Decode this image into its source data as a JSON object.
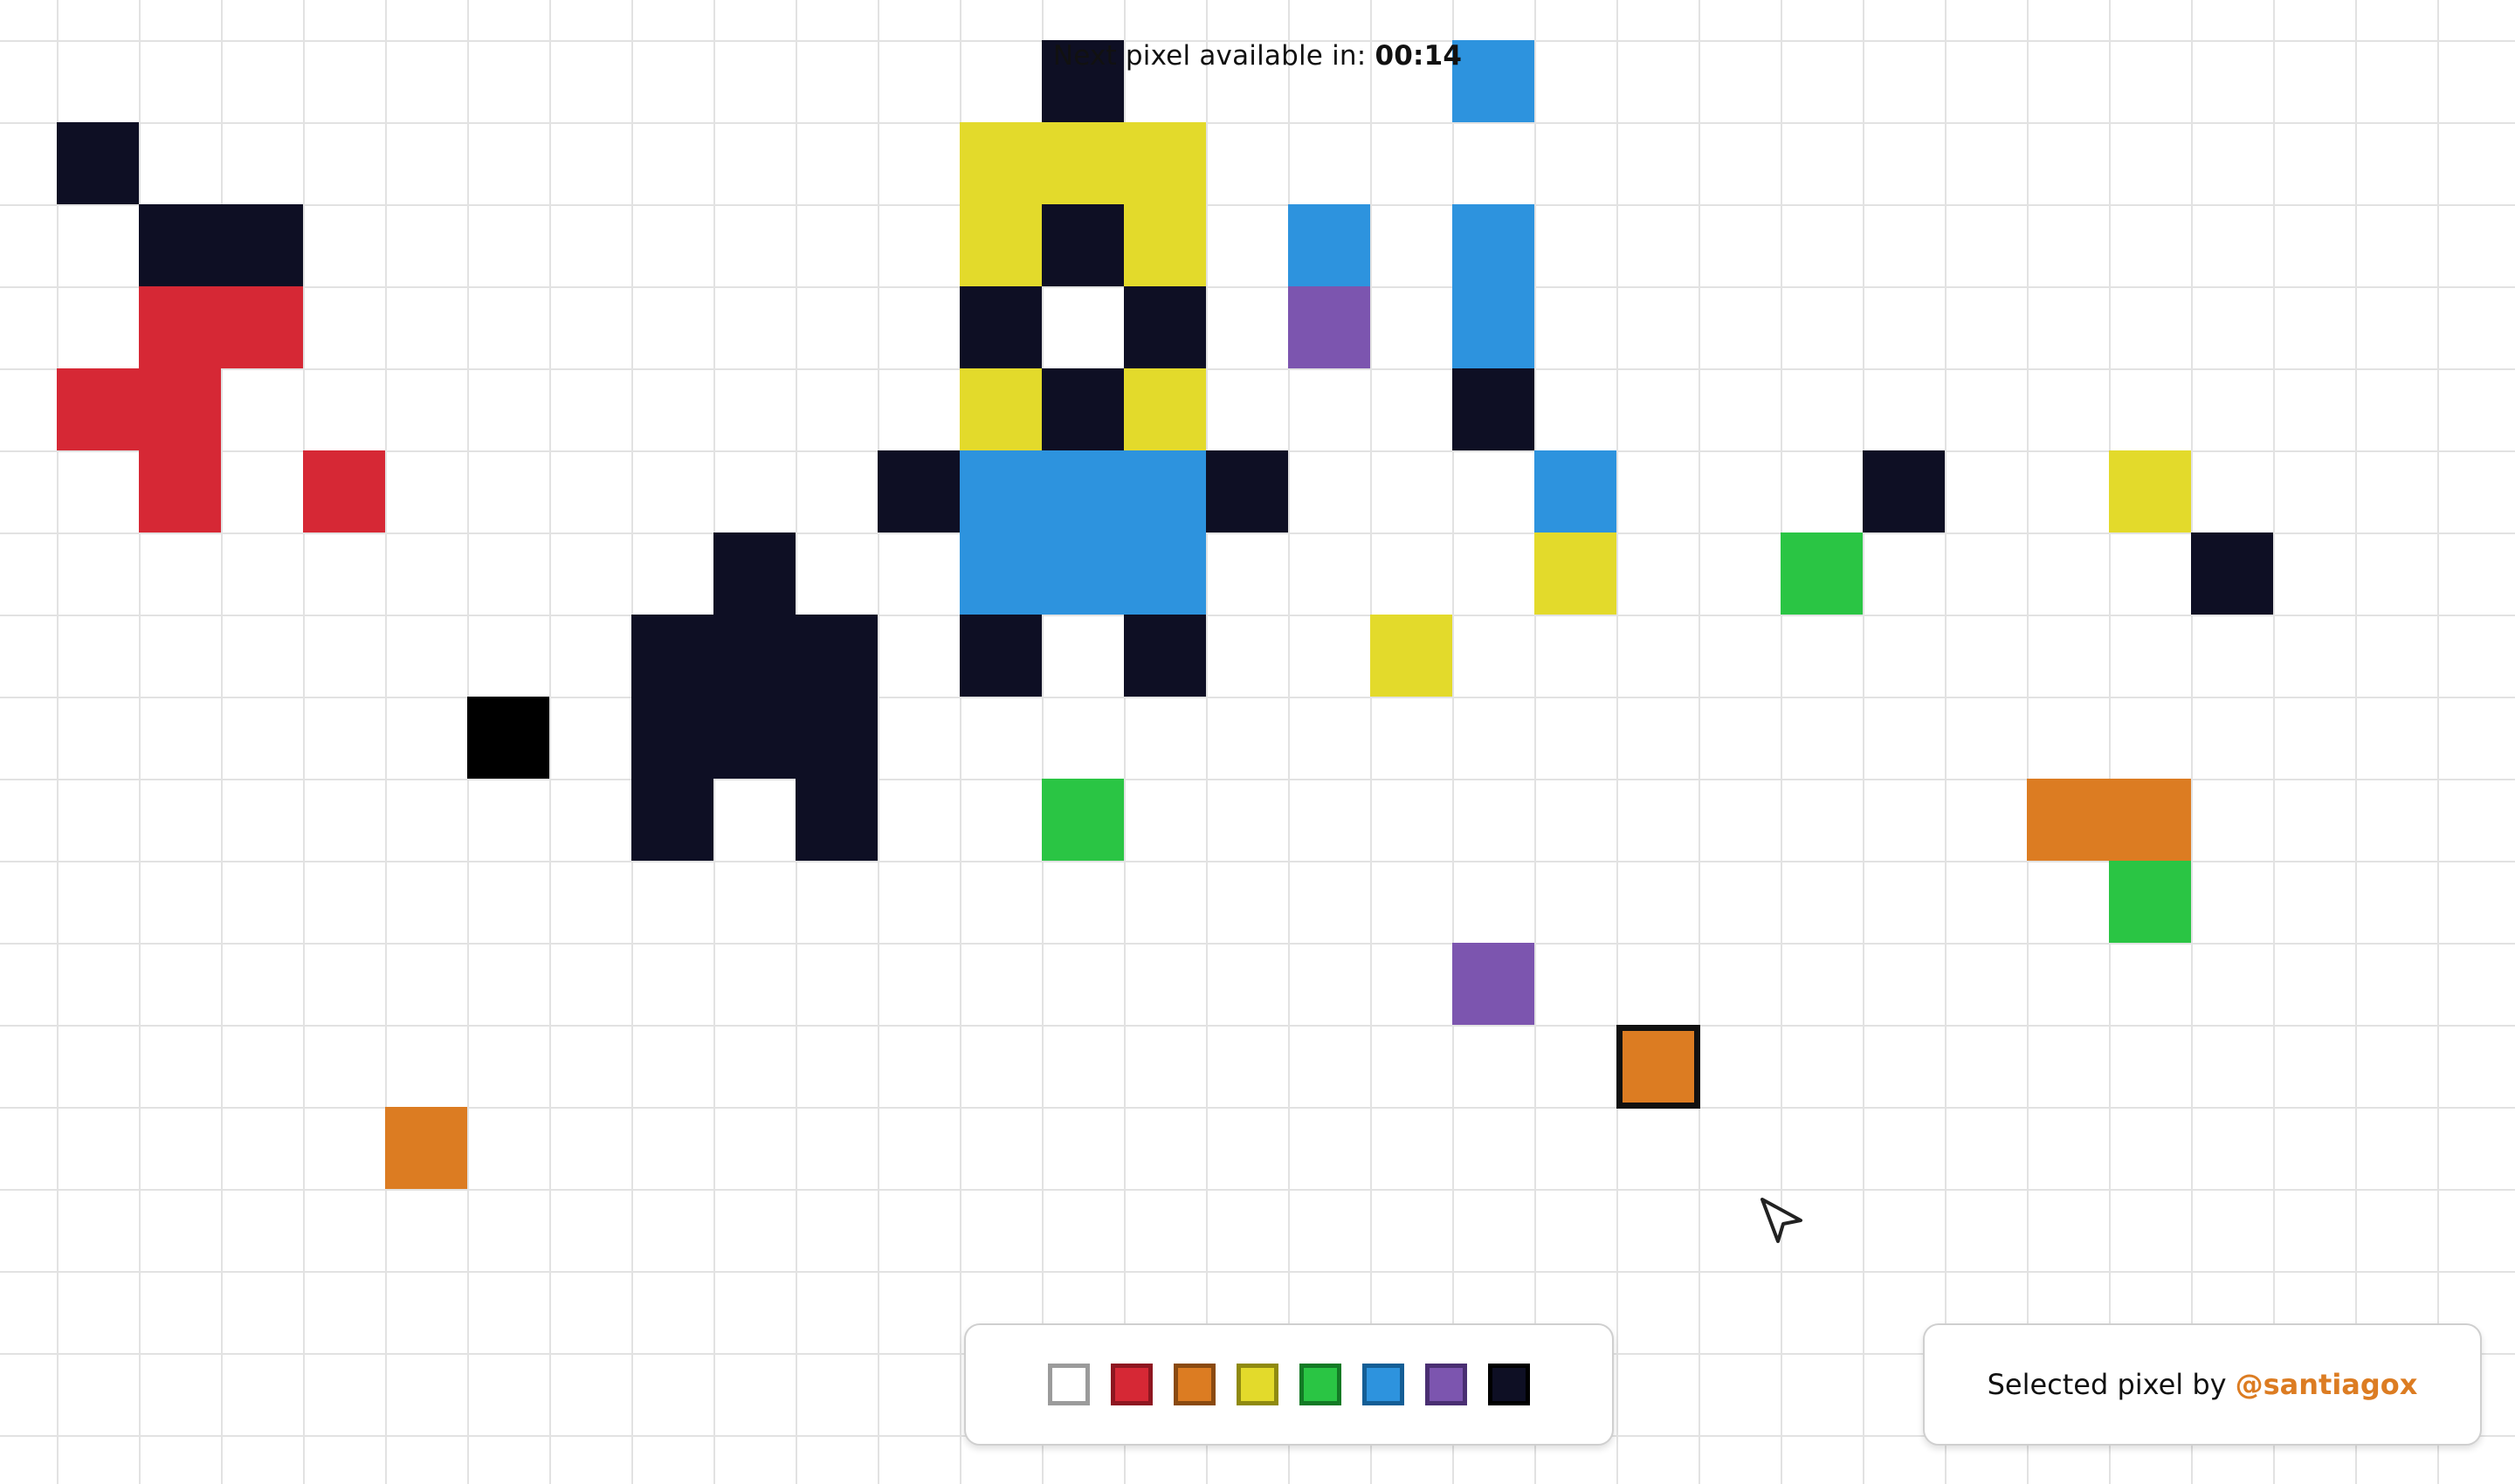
{
  "timer": {
    "label": "Next pixel available in:",
    "value": "00:14"
  },
  "palette": [
    {
      "name": "white",
      "fill": "#ffffff",
      "border": "#9b9b9b"
    },
    {
      "name": "red",
      "fill": "#d62835",
      "border": "#8e1620"
    },
    {
      "name": "orange",
      "fill": "#dc7c22",
      "border": "#8a4a10"
    },
    {
      "name": "yellow",
      "fill": "#e3da2b",
      "border": "#8f8a10"
    },
    {
      "name": "green",
      "fill": "#2ac544",
      "border": "#137a25"
    },
    {
      "name": "blue",
      "fill": "#2d93de",
      "border": "#145e96"
    },
    {
      "name": "purple",
      "fill": "#7c55af",
      "border": "#4a2f72"
    },
    {
      "name": "navy",
      "fill": "#0e0f24",
      "border": "#000000"
    }
  ],
  "selected_info": {
    "label": "Selected pixel by",
    "user": "@santiagox",
    "user_color": "#dc7c22"
  },
  "colors": {
    "R": "#d62835",
    "O": "#dc7c22",
    "Y": "#e3da2b",
    "G": "#2ac544",
    "B": "#2d93de",
    "P": "#7c55af",
    "N": "#0e0f24",
    "K": "#000000"
  },
  "pixels": [
    [
      13,
      1,
      "N"
    ],
    [
      18,
      1,
      "B"
    ],
    [
      1,
      2,
      "N"
    ],
    [
      12,
      2,
      "Y"
    ],
    [
      13,
      2,
      "Y"
    ],
    [
      14,
      2,
      "Y"
    ],
    [
      2,
      3,
      "N"
    ],
    [
      3,
      3,
      "N"
    ],
    [
      12,
      3,
      "Y"
    ],
    [
      13,
      3,
      "N"
    ],
    [
      14,
      3,
      "Y"
    ],
    [
      16,
      3,
      "B"
    ],
    [
      18,
      3,
      "B"
    ],
    [
      2,
      4,
      "R"
    ],
    [
      3,
      4,
      "R"
    ],
    [
      12,
      4,
      "N"
    ],
    [
      14,
      4,
      "N"
    ],
    [
      16,
      4,
      "P"
    ],
    [
      18,
      4,
      "B"
    ],
    [
      1,
      5,
      "R"
    ],
    [
      2,
      5,
      "R"
    ],
    [
      12,
      5,
      "Y"
    ],
    [
      13,
      5,
      "N"
    ],
    [
      14,
      5,
      "Y"
    ],
    [
      18,
      5,
      "N"
    ],
    [
      2,
      6,
      "R"
    ],
    [
      4,
      6,
      "R"
    ],
    [
      11,
      6,
      "N"
    ],
    [
      12,
      6,
      "B"
    ],
    [
      13,
      6,
      "B"
    ],
    [
      14,
      6,
      "B"
    ],
    [
      15,
      6,
      "N"
    ],
    [
      19,
      6,
      "B"
    ],
    [
      23,
      6,
      "N"
    ],
    [
      26,
      6,
      "Y"
    ],
    [
      9,
      7,
      "N"
    ],
    [
      12,
      7,
      "B"
    ],
    [
      13,
      7,
      "B"
    ],
    [
      14,
      7,
      "B"
    ],
    [
      19,
      7,
      "Y"
    ],
    [
      22,
      7,
      "G"
    ],
    [
      27,
      7,
      "N"
    ],
    [
      8,
      8,
      "N"
    ],
    [
      9,
      8,
      "N"
    ],
    [
      10,
      8,
      "N"
    ],
    [
      12,
      8,
      "N"
    ],
    [
      14,
      8,
      "N"
    ],
    [
      17,
      8,
      "Y"
    ],
    [
      6,
      9,
      "K"
    ],
    [
      8,
      9,
      "N"
    ],
    [
      9,
      9,
      "N"
    ],
    [
      10,
      9,
      "N"
    ],
    [
      8,
      10,
      "N"
    ],
    [
      10,
      10,
      "N"
    ],
    [
      13,
      10,
      "G"
    ],
    [
      25,
      10,
      "O"
    ],
    [
      26,
      10,
      "O"
    ],
    [
      26,
      11,
      "G"
    ],
    [
      18,
      12,
      "P"
    ],
    [
      5,
      14,
      "O"
    ]
  ],
  "selected_pixel": {
    "col": 20,
    "row": 13,
    "color": "O"
  }
}
